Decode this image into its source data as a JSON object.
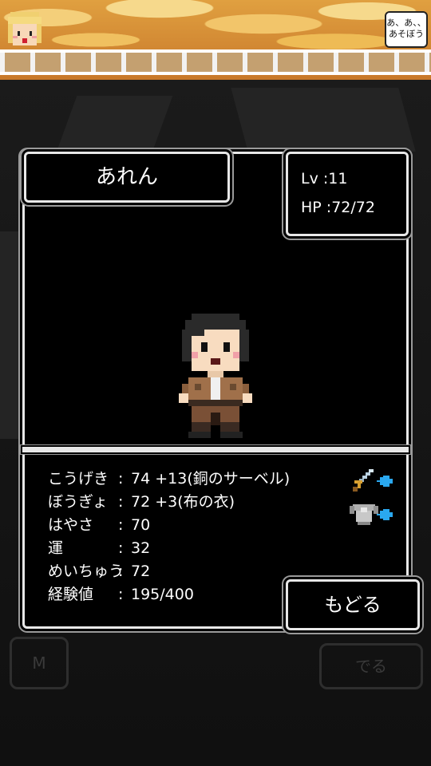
{
  "speech": {
    "text": "あ、あ、、\nあそぼう"
  },
  "character": {
    "name": "あれん"
  },
  "stats": {
    "lv_label": "Lv :",
    "lv_value": "11",
    "hp_label": "HP :",
    "hp_value": "72/72"
  },
  "status": [
    {
      "label": "こうげき",
      "colon": ":",
      "value": "74 +13(銅のサーベル)"
    },
    {
      "label": "ぼうぎょ",
      "colon": ":",
      "value": "72 +3(布の衣)"
    },
    {
      "label": "はやさ",
      "colon": ":",
      "value": "70"
    },
    {
      "label": "運",
      "colon": ":",
      "value": "32"
    },
    {
      "label": "めいちゅう",
      "colon": ":",
      "value": "72"
    },
    {
      "label": "経験値",
      "colon": ":",
      "value": "195/400"
    }
  ],
  "buttons": {
    "back": "もどる",
    "menu_ghost": "M",
    "exit_ghost": "でる"
  },
  "icons": {
    "weapon": "sword-icon",
    "armor": "armor-icon",
    "arrow": "blue-arrow-icon"
  },
  "colors": {
    "border": "#e8e8e8",
    "accent_arrow": "#2aa8f0"
  }
}
